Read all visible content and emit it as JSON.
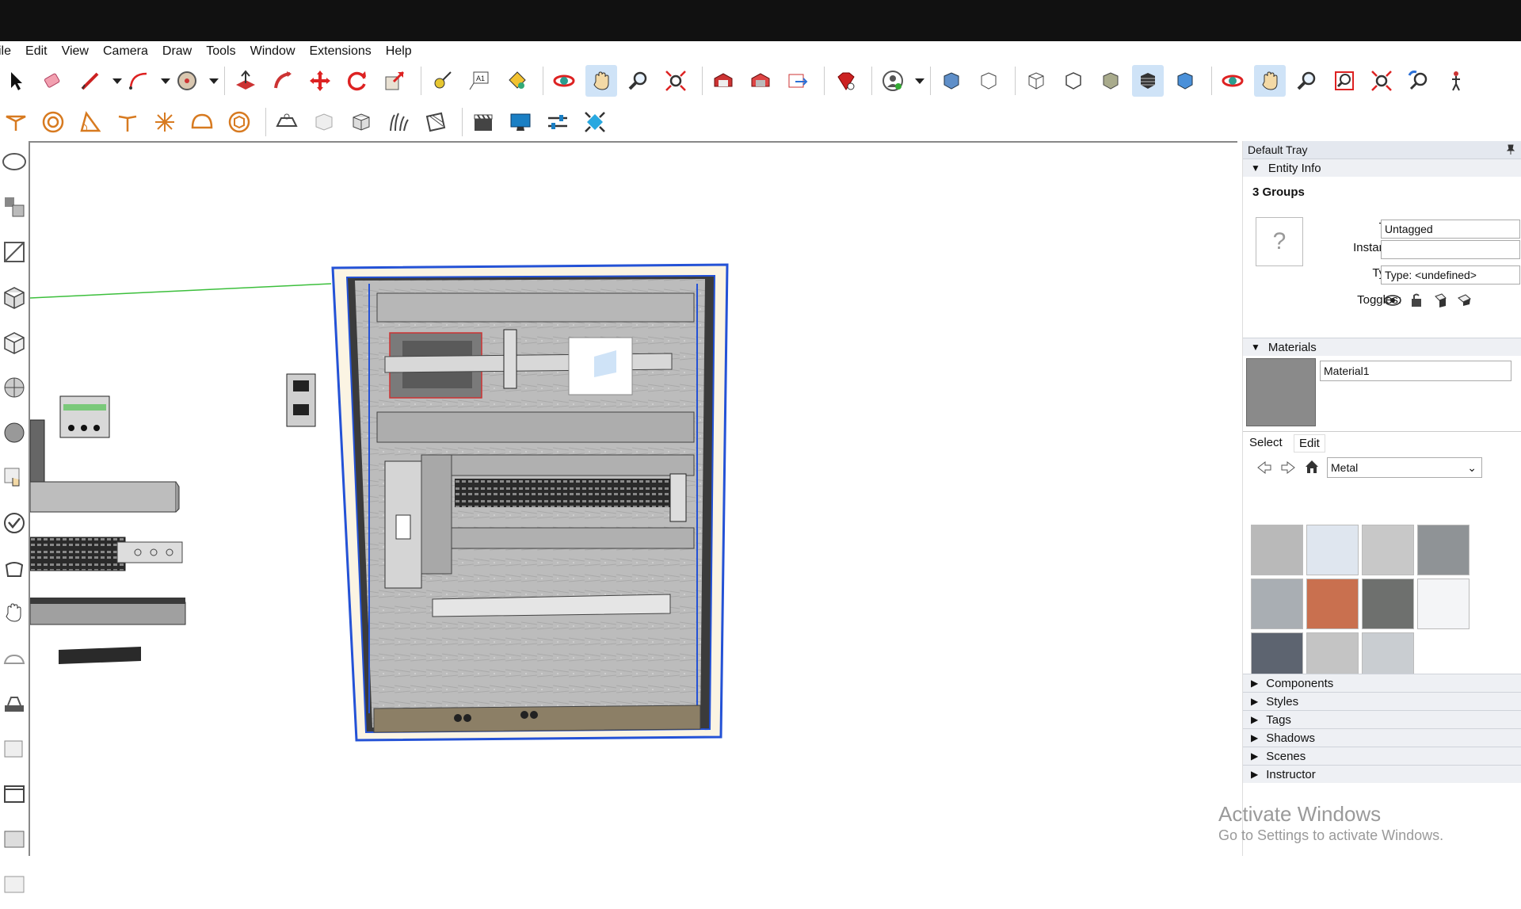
{
  "menu": [
    "ile",
    "Edit",
    "View",
    "Camera",
    "Draw",
    "Tools",
    "Window",
    "Extensions",
    "Help"
  ],
  "toolbar1": [
    {
      "icon": "select-arrow-icon"
    },
    {
      "icon": "eraser-icon"
    },
    {
      "icon": "pencil-line-icon"
    },
    {
      "icon": "dropdown-icon"
    },
    {
      "icon": "arc-icon"
    },
    {
      "icon": "dropdown-icon"
    },
    {
      "icon": "circle-icon"
    },
    {
      "icon": "dropdown-icon"
    },
    {
      "icon": "push-pull-icon"
    },
    {
      "icon": "follow-me-icon"
    },
    {
      "icon": "move-icon"
    },
    {
      "icon": "rotate-icon"
    },
    {
      "icon": "scale-icon"
    },
    {
      "icon": "tape-measure-icon"
    },
    {
      "icon": "text-icon"
    },
    {
      "icon": "paint-bucket-icon"
    },
    {
      "icon": "orbit-icon"
    },
    {
      "icon": "pan-icon"
    },
    {
      "icon": "zoom-icon"
    },
    {
      "icon": "zoom-extents-icon"
    },
    {
      "icon": "warehouse-icon"
    },
    {
      "icon": "extension-warehouse-icon"
    },
    {
      "icon": "send-to-layout-icon"
    },
    {
      "icon": "ruby-icon"
    },
    {
      "icon": "account-icon"
    },
    {
      "icon": "iso-view-icon"
    },
    {
      "icon": "top-view-icon"
    },
    {
      "icon": "xray-icon"
    },
    {
      "icon": "wireframe-icon"
    },
    {
      "icon": "shaded-icon"
    },
    {
      "icon": "shaded-texture-icon"
    },
    {
      "icon": "monochrome-icon"
    },
    {
      "icon": "orbit-icon"
    },
    {
      "icon": "pan-icon"
    },
    {
      "icon": "zoom-icon"
    },
    {
      "icon": "zoom-window-icon"
    },
    {
      "icon": "zoom-extents-icon"
    },
    {
      "icon": "previous-view-icon"
    },
    {
      "icon": "walk-icon"
    }
  ],
  "toolbar2": [
    {
      "icon": "sandbox-from-contours-icon"
    },
    {
      "icon": "circle-target-icon"
    },
    {
      "icon": "protractor-icon"
    },
    {
      "icon": "axes-icon"
    },
    {
      "icon": "section-plane-icon"
    },
    {
      "icon": "dome-icon"
    },
    {
      "icon": "component-icon"
    },
    {
      "icon": "add-location-icon"
    },
    {
      "icon": "box-icon"
    },
    {
      "icon": "box-open-icon"
    },
    {
      "icon": "grass-icon"
    },
    {
      "icon": "drape-icon"
    },
    {
      "icon": "scene-clapper-icon"
    },
    {
      "icon": "display-icon"
    },
    {
      "icon": "sliders-icon"
    },
    {
      "icon": "move-tool-icon"
    }
  ],
  "tray": {
    "title": "Default Tray",
    "entity_info": {
      "header": "Entity Info",
      "selection": "3 Groups",
      "tag_label": "Tag:",
      "tag_value": "Untagged",
      "instance_label": "Instance:",
      "instance_value": "",
      "type_label": "Type:",
      "type_value": "Type: <undefined>",
      "toggles_label": "Toggles:"
    },
    "materials": {
      "header": "Materials",
      "material_name": "Material1",
      "tab_select": "Select",
      "tab_edit": "Edit",
      "library": "Metal",
      "swatch_colors": [
        "#b9b9b9",
        "#dfe6ef",
        "#c8c8c8",
        "#8f9396",
        "#a9aeb3",
        "#c9704f",
        "#6e706e",
        "#f4f5f7",
        "#5d6470",
        "#c4c4c4",
        "#c9cdd1"
      ]
    },
    "sections": [
      "Components",
      "Styles",
      "Tags",
      "Shadows",
      "Scenes",
      "Instructor"
    ]
  },
  "watermark": {
    "line1": "Activate Windows",
    "line2": "Go to Settings to activate Windows."
  }
}
